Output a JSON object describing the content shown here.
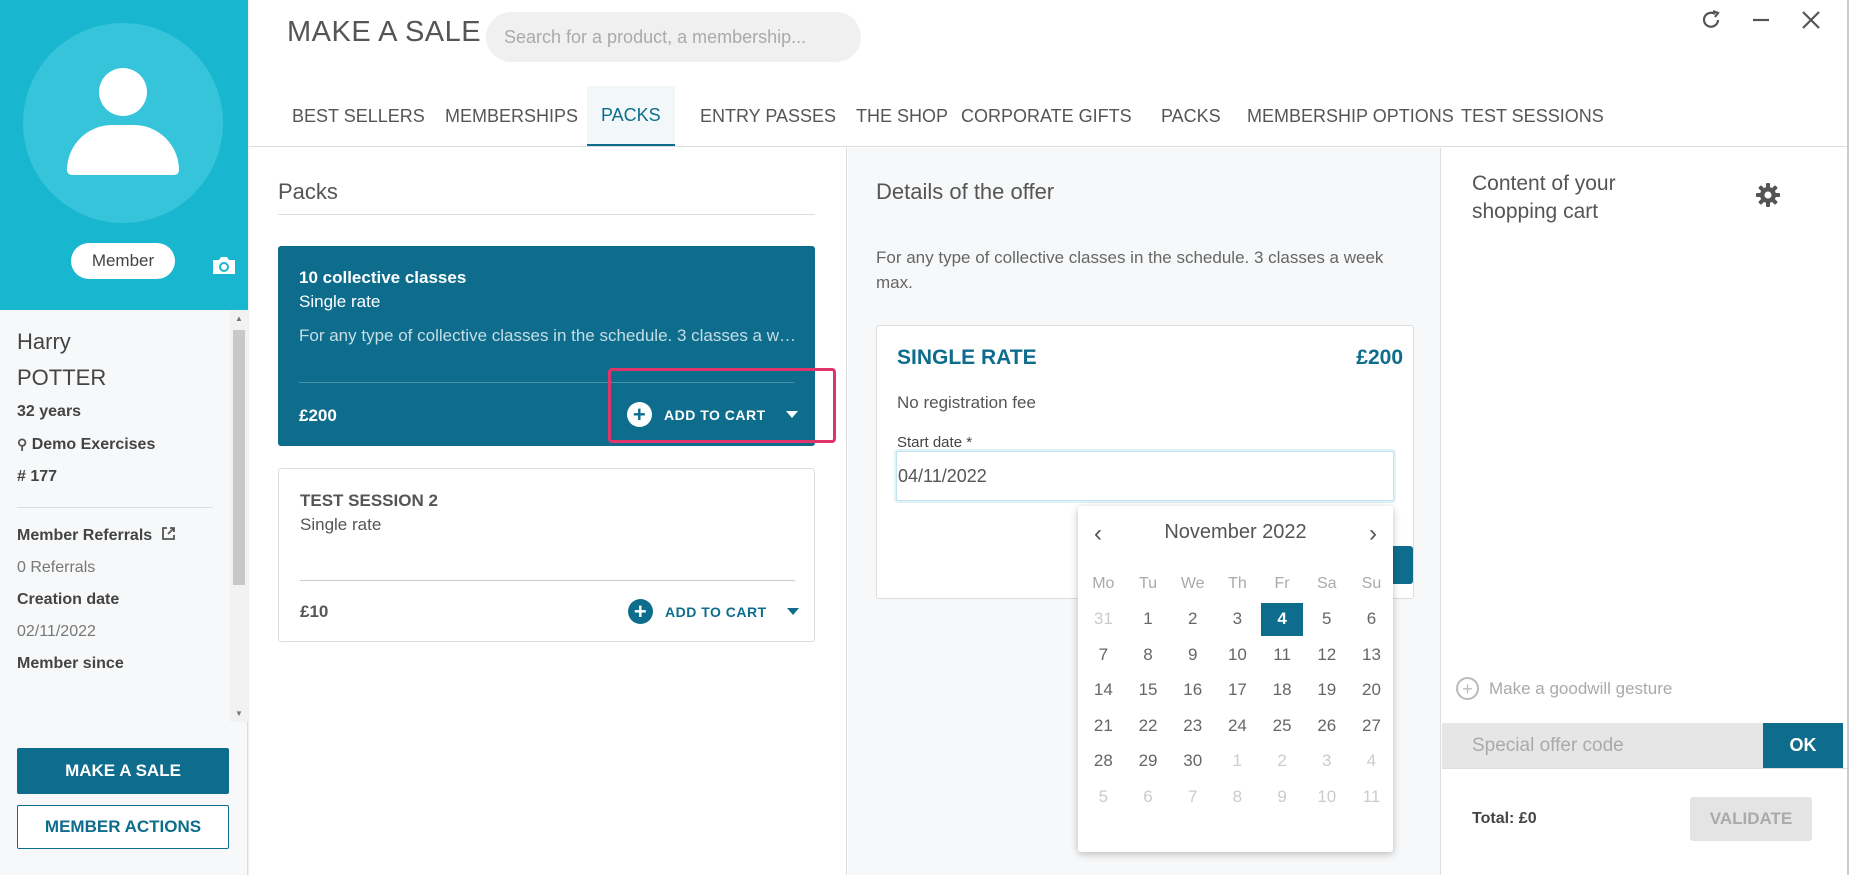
{
  "member": {
    "badge": "Member",
    "first_name": "Harry",
    "last_name": "POTTER",
    "age": "32 years",
    "location": "Demo Exercises",
    "member_number": "# 177",
    "referrals_label": "Member Referrals",
    "referrals_count": "0 Referrals",
    "creation_date_label": "Creation date",
    "creation_date": "02/11/2022",
    "member_since_label": "Member since"
  },
  "sidebar_actions": {
    "make_sale": "MAKE A SALE",
    "member_actions": "MEMBER ACTIONS"
  },
  "header": {
    "title": "MAKE A SALE",
    "search_placeholder": "Search for a product, a membership..."
  },
  "tabs": [
    {
      "label": "BEST SELLERS"
    },
    {
      "label": "MEMBERSHIPS"
    },
    {
      "label": "PACKS"
    },
    {
      "label": "ENTRY PASSES"
    },
    {
      "label": "THE SHOP"
    },
    {
      "label": "CORPORATE GIFTS"
    },
    {
      "label": "PACKS"
    },
    {
      "label": "MEMBERSHIP OPTIONS"
    },
    {
      "label": "TEST SESSIONS"
    }
  ],
  "packs": {
    "title": "Packs",
    "items": [
      {
        "title": "10 collective classes",
        "subtitle": "Single rate",
        "description": "For any type of collective classes in the schedule. 3 classes a week max.",
        "price": "£200",
        "add_label": "ADD TO CART"
      },
      {
        "title": "TEST SESSION 2",
        "subtitle": "Single rate",
        "price": "£10",
        "add_label": "ADD TO CART"
      }
    ]
  },
  "details": {
    "title": "Details of the offer",
    "description": "For any type of collective classes in the schedule. 3 classes a week max.",
    "rate_name": "SINGLE RATE",
    "rate_price": "£200",
    "fee": "No registration fee",
    "start_date_label": "Start date *",
    "start_date_value": "04/11/2022"
  },
  "calendar": {
    "month": "November 2022",
    "weekdays": [
      "Mo",
      "Tu",
      "We",
      "Th",
      "Fr",
      "Sa",
      "Su"
    ],
    "days": [
      [
        "31",
        "1",
        "2",
        "3",
        "4",
        "5",
        "6"
      ],
      [
        "7",
        "8",
        "9",
        "10",
        "11",
        "12",
        "13"
      ],
      [
        "14",
        "15",
        "16",
        "17",
        "18",
        "19",
        "20"
      ],
      [
        "21",
        "22",
        "23",
        "24",
        "25",
        "26",
        "27"
      ],
      [
        "28",
        "29",
        "30",
        "1",
        "2",
        "3",
        "4"
      ],
      [
        "5",
        "6",
        "7",
        "8",
        "9",
        "10",
        "11"
      ]
    ],
    "selected_day": "4"
  },
  "cart": {
    "title": "Content of your shopping cart",
    "goodwill": "Make a goodwill gesture",
    "offer_code_placeholder": "Special offer code",
    "ok": "OK",
    "total": "Total: £0",
    "validate": "VALIDATE"
  },
  "colors": {
    "primary": "#0e6d8c",
    "profile_bg": "#19b6cf",
    "highlight": "#e0356b"
  }
}
